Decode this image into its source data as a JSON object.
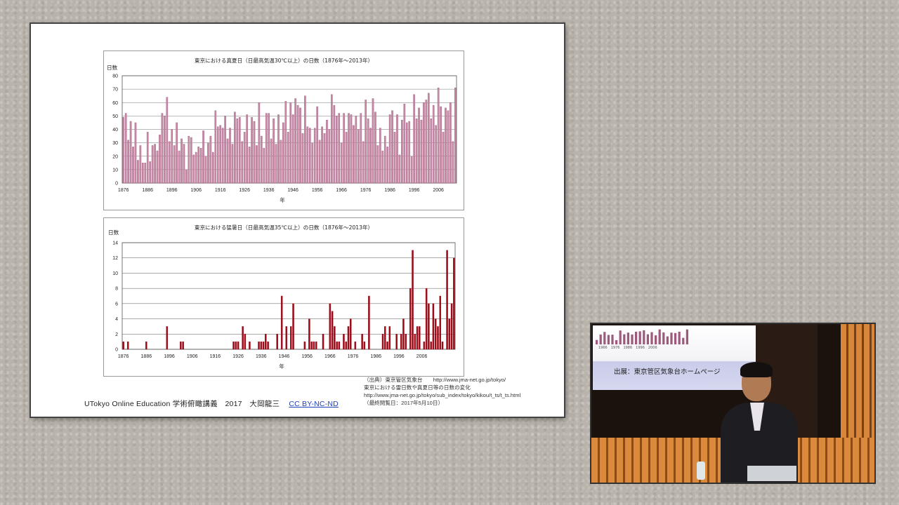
{
  "slide": {
    "footer": "UTokyo Online Education 学術俯瞰講義　2017　大岡龍三",
    "license": "CC BY-NC-ND",
    "source_lines": [
      "（出典）東京管区気象台　　http://www.jma-net.go.jp/tokyo/",
      "東京における雷日数や真夏日等の日数の変化",
      "http://www.jma-net.go.jp/tokyo/sub_index/tokyo/kikou/t_ts/t_ts.html",
      "（最終閲覧日：2017年5月10日）"
    ]
  },
  "video": {
    "subtitle": "出展：東京管区気象台ホームページ",
    "screen_ticks": "1966　1976　1986　1996　2006"
  },
  "colors": {
    "chart1_bar": "#c98aa8",
    "chart1_bar_edge": "#9c5b7c",
    "chart2_bar": "#9c0a18"
  },
  "chart_data": [
    {
      "type": "bar",
      "title": "東京における真夏日（日最高気温30℃以上）の日数（1876年～2013年）",
      "ylabel": "日数",
      "xlabel": "年",
      "ylim": [
        0,
        80
      ],
      "yticks": [
        0,
        10,
        20,
        30,
        40,
        50,
        60,
        70,
        80
      ],
      "xticks": [
        "1876",
        "1886",
        "1896",
        "1906",
        "1916",
        "1926",
        "1936",
        "1946",
        "1956",
        "1966",
        "1976",
        "1986",
        "1996",
        "2006"
      ],
      "x_start": 1876,
      "values": [
        49,
        52,
        32,
        46,
        27,
        45,
        17,
        28,
        15,
        15,
        38,
        16,
        28,
        29,
        24,
        36,
        52,
        50,
        64,
        31,
        40,
        28,
        45,
        24,
        33,
        29,
        10,
        35,
        34,
        21,
        23,
        27,
        26,
        39,
        20,
        30,
        35,
        23,
        54,
        42,
        43,
        41,
        50,
        33,
        41,
        29,
        53,
        48,
        49,
        31,
        38,
        51,
        27,
        49,
        46,
        28,
        60,
        35,
        26,
        52,
        52,
        33,
        48,
        29,
        51,
        32,
        45,
        61,
        38,
        60,
        51,
        63,
        58,
        56,
        37,
        65,
        42,
        41,
        30,
        41,
        57,
        32,
        42,
        37,
        47,
        40,
        66,
        58,
        50,
        52,
        30,
        52,
        38,
        52,
        51,
        43,
        50,
        40,
        52,
        31,
        62,
        48,
        41,
        63,
        53,
        28,
        41,
        24,
        35,
        27,
        51,
        54,
        38,
        51,
        21,
        47,
        59,
        45,
        46,
        20,
        66,
        48,
        56,
        47,
        60,
        62,
        67,
        48,
        58,
        43,
        71,
        57,
        38,
        56,
        54,
        60,
        31,
        71
      ]
    },
    {
      "type": "bar",
      "title": "東京における猛暑日（日最高気温35℃以上）の日数（1876年～2013年）",
      "ylabel": "日数",
      "xlabel": "年",
      "ylim": [
        0,
        14
      ],
      "yticks": [
        0,
        2,
        4,
        6,
        8,
        10,
        12,
        14
      ],
      "xticks": [
        "1876",
        "1886",
        "1896",
        "1906",
        "1916",
        "1926",
        "1936",
        "1946",
        "1956",
        "1966",
        "1976",
        "1986",
        "1996",
        "2006"
      ],
      "x_start": 1876,
      "values": [
        1,
        0,
        1,
        0,
        0,
        0,
        0,
        0,
        0,
        0,
        1,
        0,
        0,
        0,
        0,
        0,
        0,
        0,
        0,
        3,
        0,
        0,
        0,
        0,
        0,
        1,
        1,
        0,
        0,
        0,
        0,
        0,
        0,
        0,
        0,
        0,
        0,
        0,
        0,
        0,
        0,
        0,
        0,
        0,
        0,
        0,
        0,
        0,
        1,
        1,
        1,
        0,
        3,
        2,
        0,
        1,
        0,
        0,
        0,
        1,
        1,
        1,
        2,
        1,
        0,
        0,
        0,
        2,
        0,
        7,
        0,
        3,
        0,
        3,
        6,
        0,
        0,
        0,
        0,
        1,
        0,
        4,
        1,
        1,
        1,
        0,
        0,
        2,
        0,
        0,
        6,
        5,
        3,
        1,
        1,
        0,
        2,
        1,
        3,
        4,
        0,
        1,
        0,
        0,
        2,
        1,
        0,
        7,
        0,
        0,
        0,
        0,
        0,
        2,
        3,
        1,
        3,
        0,
        0,
        2,
        0,
        2,
        4,
        2,
        0,
        8,
        13,
        2,
        3,
        3,
        0,
        1,
        8,
        6,
        1,
        6,
        4,
        3,
        7,
        1,
        0,
        13,
        4,
        6,
        12
      ]
    }
  ]
}
